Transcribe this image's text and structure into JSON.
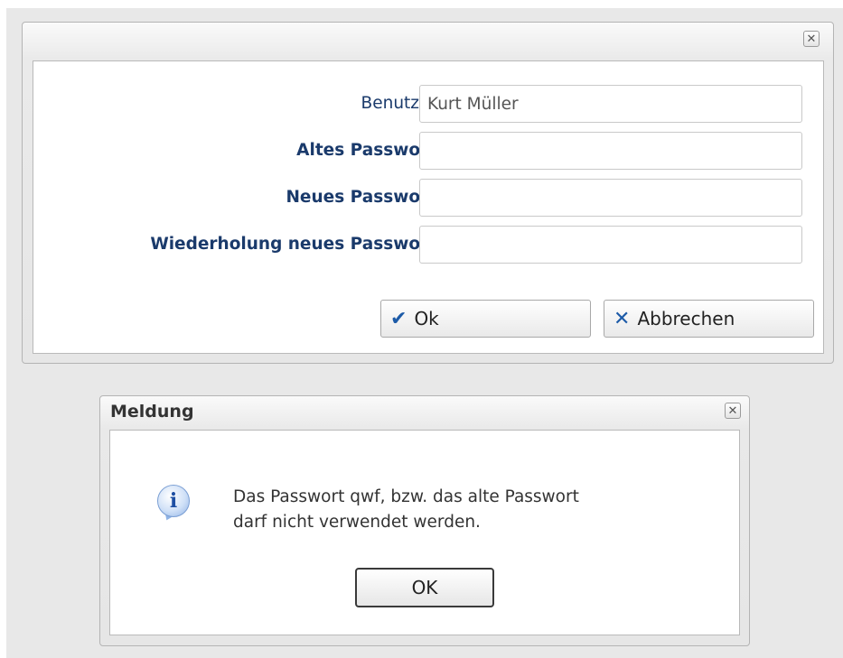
{
  "change_password_dialog": {
    "close_symbol": "✕",
    "fields": [
      {
        "label": "Benutzer",
        "value": "Kurt Müller",
        "bold": false
      },
      {
        "label": "Altes Passwort",
        "value": "",
        "bold": true
      },
      {
        "label": "Neues Passwort",
        "value": "",
        "bold": true
      },
      {
        "label": "Wiederholung neues Passwort",
        "value": "",
        "bold": true
      }
    ],
    "ok_button": {
      "icon": "check-icon",
      "symbol": "✔",
      "label": "Ok"
    },
    "cancel_button": {
      "icon": "close-icon",
      "symbol": "✕",
      "label": "Abbrechen"
    }
  },
  "message_dialog": {
    "title": "Meldung",
    "close_symbol": "✕",
    "icon": "info-icon",
    "icon_symbol": "i",
    "message_line1": "Das Passwort qwf, bzw. das alte Passwort",
    "message_line2": "darf nicht verwendet werden.",
    "ok_label": "OK"
  },
  "colors": {
    "label_text": "#1a3a6b",
    "button_icon": "#1d5ba8",
    "background": "#e8e8e8"
  }
}
